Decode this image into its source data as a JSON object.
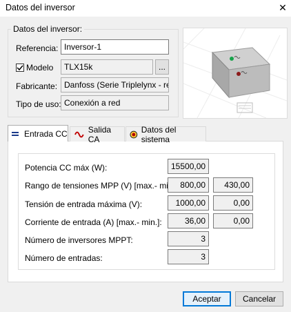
{
  "window": {
    "title": "Datos del inversor",
    "close_glyph": "✕"
  },
  "inverter_group": {
    "legend": "Datos del inversor:",
    "referencia_label": "Referencia:",
    "referencia_value": "Inversor-1",
    "modelo_label": "Modelo",
    "modelo_checked": true,
    "modelo_value": "TLX15k",
    "browse_label": "...",
    "fabricante_label": "Fabricante:",
    "fabricante_value": "Danfoss (Serie Triplelynx - red)",
    "tipo_uso_label": "Tipo de uso:",
    "tipo_uso_value": "Conexión a red"
  },
  "tabs": [
    {
      "label": "Entrada CC",
      "icon": "dc-icon",
      "active": true
    },
    {
      "label": "Salida CA",
      "icon": "ac-wave-icon",
      "active": false
    },
    {
      "label": "Datos del sistema",
      "icon": "target-icon",
      "active": false
    }
  ],
  "entrada_cc": {
    "potencia_label": "Potencia CC máx (W):",
    "potencia_value": "15500,00",
    "rango_label": "Rango de tensiones MPP (V) [max.- min.]:",
    "rango_max": "800,00",
    "rango_min": "430,00",
    "tension_label": "Tensión de entrada máxima (V):",
    "tension_value": "1000,00",
    "tension_second": "0,00",
    "corriente_label": "Corriente de entrada (A) [max.- min.]:",
    "corriente_max": "36,00",
    "corriente_min": "0,00",
    "mppt_label": "Número de inversores MPPT:",
    "mppt_value": "3",
    "entradas_label": "Número de entradas:",
    "entradas_value": "3"
  },
  "footer": {
    "accept_label": "Aceptar",
    "cancel_label": "Cancelar"
  },
  "colors": {
    "accent": "#0078d7",
    "tab_dc_icon": "#1a3a8a",
    "tab_ac_icon": "#c00000",
    "tab_sys_icon": "#b00000"
  }
}
